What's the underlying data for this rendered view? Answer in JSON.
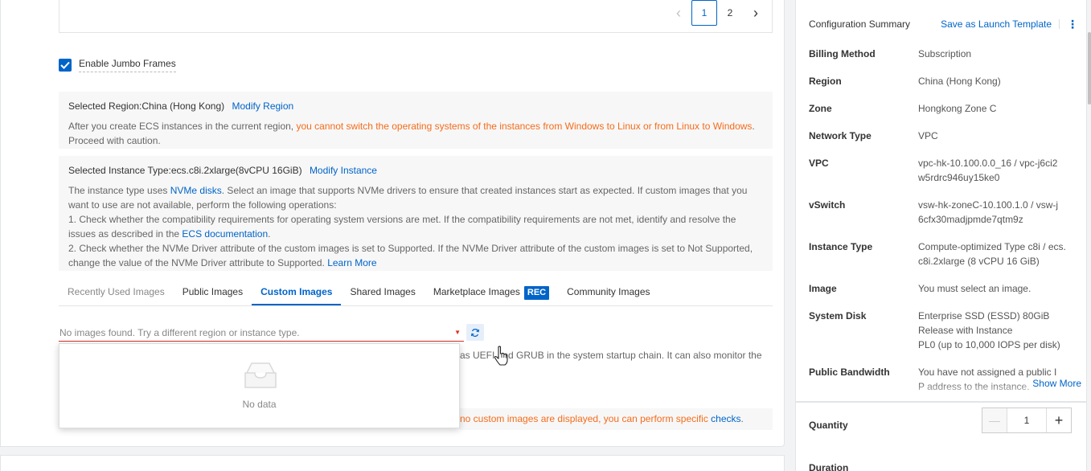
{
  "pagination": {
    "prev": "‹",
    "page1": "1",
    "page2": "2",
    "next": "›"
  },
  "jumbo": {
    "label": "Enable Jumbo Frames",
    "checked": true
  },
  "region_notice": {
    "title": "Selected Region:China (Hong Kong)",
    "link": "Modify Region",
    "text_prefix": "After you create ECS instances in the current region, ",
    "text_warning": "you cannot switch the operating systems of the instances from Windows to Linux or from Linux to Windows",
    "text_suffix": ".",
    "text_line2": "Proceed with caution."
  },
  "instance_notice": {
    "title": "Selected Instance Type:ecs.c8i.2xlarge(8vCPU 16GiB)",
    "link": "Modify Instance",
    "p1_a": "The instance type uses ",
    "p1_link": "NVMe disks",
    "p1_b": ". Select an image that supports NVMe drivers to ensure that created instances start as expected. If custom images that you want to use are not available, perform the following operations:",
    "p2_a": "1. Check whether the compatibility requirements for operating system versions are met. If the compatibility requirements are not met, identify and resolve the issues as described in the ",
    "p2_link": "ECS documentation",
    "p2_b": ".",
    "p3_a": "2. Check whether the NVMe Driver attribute of the custom images is set to Supported. If the NVMe Driver attribute of the custom images is set to Not Supported, change the value of the NVMe Driver attribute to Supported. ",
    "p3_link": "Learn More"
  },
  "image_tabs": [
    {
      "label": "Recently Used Images"
    },
    {
      "label": "Public Images"
    },
    {
      "label": "Custom Images"
    },
    {
      "label": "Shared Images"
    },
    {
      "label": "Marketplace Images",
      "badge": "REC"
    },
    {
      "label": "Community Images"
    }
  ],
  "image_select": {
    "placeholder": "No images found. Try a different region or instance type."
  },
  "behind_text": "as UEFI and GRUB in the system startup chain. It can also monitor the",
  "warn_strip": {
    "text": "no custom images are displayed, you can perform specific ",
    "link": "checks",
    "end": "."
  },
  "dropdown": {
    "empty_text": "No data"
  },
  "summary": {
    "title": "Configuration Summary",
    "save_template": "Save as Launch Template",
    "rows": [
      {
        "key": "Billing Method",
        "value": "Subscription"
      },
      {
        "key": "Region",
        "value": "China (Hong Kong)"
      },
      {
        "key": "Zone",
        "value": "Hongkong Zone C"
      },
      {
        "key": "Network Type",
        "value": "VPC"
      },
      {
        "key": "VPC",
        "value": "vpc-hk-10.100.0.0_16 / vpc-j6ci2w5rdrc946uy15ke0"
      },
      {
        "key": "vSwitch",
        "value": "vsw-hk-zoneC-10.100.1.0 / vsw-j6cfx30madjpmde7qtm9z"
      },
      {
        "key": "Instance Type",
        "value": "Compute-optimized Type c8i / ecs.c8i.2xlarge (8 vCPU 16 GiB)"
      },
      {
        "key": "Image",
        "value": "You must select an image."
      },
      {
        "key": "System Disk",
        "value_lines": [
          "Enterprise SSD (ESSD) 80GiB",
          "Release with Instance",
          "PL0 (up to 10,000 IOPS per disk)"
        ]
      },
      {
        "key": "Public Bandwidth",
        "value": "You have not assigned a public IP address to the instance."
      }
    ],
    "show_more": "Show More"
  },
  "quantity": {
    "label": "Quantity",
    "value": "1",
    "minus": "—",
    "plus": "+"
  },
  "duration": {
    "label": "Duration"
  },
  "colors": {
    "accent": "#0064c8",
    "warning": "#f56c1b",
    "error": "#d93026"
  }
}
